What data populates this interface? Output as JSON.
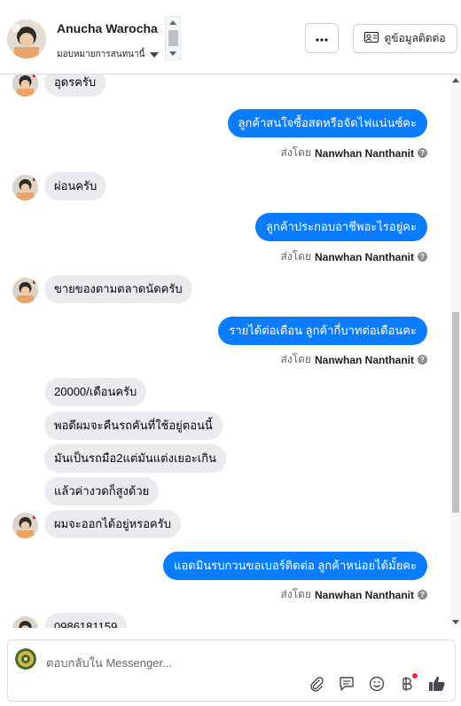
{
  "header": {
    "contact_name": "Anucha Warocha",
    "assign_label": "มอบหมายการสนทนานี้",
    "contact_info_label": "ดูข้อมูลติดต่อ"
  },
  "colors": {
    "outgoing_bubble": "#0a7cff",
    "incoming_bubble": "#e9ebee"
  },
  "messages": {
    "m1": "อุดรครับ",
    "m2": "ลูกค้าสนใจซื้อสดหรือจัดไฟแน่นซ์คะ",
    "m3": "ผ่อนครับ",
    "m4": "ลูกค้าประกอบอาชีพอะไรอยู่คะ",
    "m5": "ขายของตามตลาดนัดครับ",
    "m6": "รายได้ต่อเดือน ลูกค้ากี่บาทต่อเดือนคะ",
    "m7": "20000/เดือนครับ",
    "m8": "พอดีผมจะคืนรถคันที่ใช้อยู่ตอนนี้",
    "m9": "มันเป็นรถมือ2แต่มันแต่งเยอะเกิน",
    "m10": "แล้วค่างวดก็สูงด้วย",
    "m11": "ผมจะออกได้อยู่หรอครับ",
    "m12": "แอดมินรบกวนขอเบอร์ติดต่อ ลูกค้าหน่อยได้มั้ยคะ",
    "m13": "0986181159"
  },
  "sent_by": {
    "prefix": "ส่งโดย",
    "name": "Nanwhan Nanthanit"
  },
  "composer": {
    "placeholder": "ตอบกลับใน Messenger..."
  }
}
